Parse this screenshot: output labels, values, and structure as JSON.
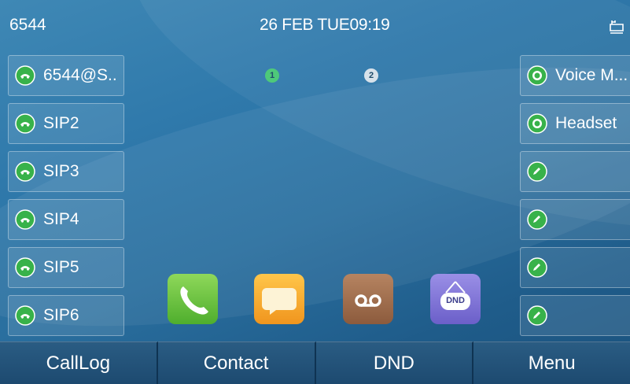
{
  "status": {
    "extension": "6544",
    "datetime": "26 FEB TUE09:19"
  },
  "page_indicators": [
    "1",
    "2"
  ],
  "left_keys": [
    "6544@S..",
    "SIP2",
    "SIP3",
    "SIP4",
    "SIP5",
    "SIP6"
  ],
  "right_keys": [
    "Voice M...",
    "Headset",
    "",
    "",
    "",
    ""
  ],
  "dnd_label": "DND",
  "softkeys": [
    "CallLog",
    "Contact",
    "DND",
    "Menu"
  ],
  "colors": {
    "line_key_icon": "#38b24a",
    "page_1_active": "#4ec97a",
    "page_2_inactive": "#d8e2ea"
  }
}
